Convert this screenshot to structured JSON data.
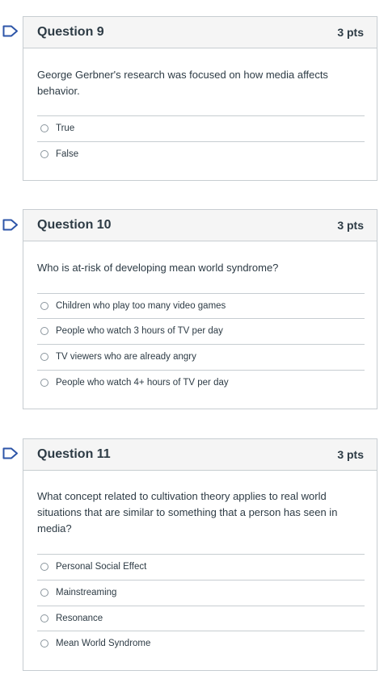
{
  "questions": [
    {
      "title": "Question 9",
      "points": "3 pts",
      "text": "George Gerbner's research was focused on how media affects behavior.",
      "answers": [
        "True",
        "False"
      ]
    },
    {
      "title": "Question 10",
      "points": "3 pts",
      "text": "Who is at-risk of developing mean world syndrome?",
      "answers": [
        "Children who play too many video games",
        "People who watch 3 hours of TV per day",
        "TV viewers who are already angry",
        "People who watch 4+ hours of TV per day"
      ]
    },
    {
      "title": "Question 11",
      "points": "3 pts",
      "text": "What concept related to cultivation theory applies to real world situations that are similar to something that a person has seen in media?",
      "answers": [
        "Personal Social Effect",
        "Mainstreaming",
        "Resonance",
        "Mean World Syndrome"
      ]
    }
  ],
  "colors": {
    "flag_outline": "#2d55a8",
    "border": "#c7cdd1",
    "header_bg": "#f5f5f5",
    "text": "#2d3b45"
  },
  "icons": {
    "flag": "bookmark-flag-icon",
    "radio": "radio-unselected-icon"
  }
}
